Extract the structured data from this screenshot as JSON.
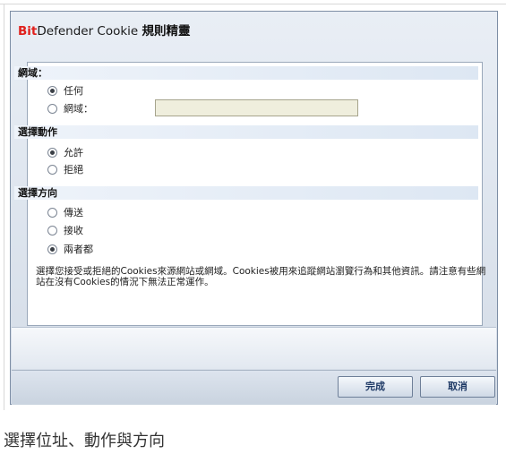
{
  "dialog": {
    "title_brand_red": "Bit",
    "title_brand_rest": "Defender Cookie ",
    "title_suffix": "規則精靈"
  },
  "sections": {
    "domain": {
      "heading": "網域：",
      "options": [
        "任何",
        "網域："
      ],
      "selected": "任何",
      "domain_input_value": ""
    },
    "action": {
      "heading": "選擇動作",
      "options": [
        "允許",
        "拒絕"
      ],
      "selected": "允許"
    },
    "direction": {
      "heading": "選擇方向",
      "options": [
        "傳送",
        "接收",
        "兩者都"
      ],
      "selected": "兩者都"
    }
  },
  "info_text": "選擇您接受或拒絕的Cookies來源網站或網域。Cookies被用來追蹤網站瀏覽行為和其他資訊。請注意有些網站在沒有Cookies的情況下無法正常運作。",
  "buttons": {
    "finish": "完成",
    "cancel": "取消"
  },
  "caption": "選擇位址、動作與方向"
}
